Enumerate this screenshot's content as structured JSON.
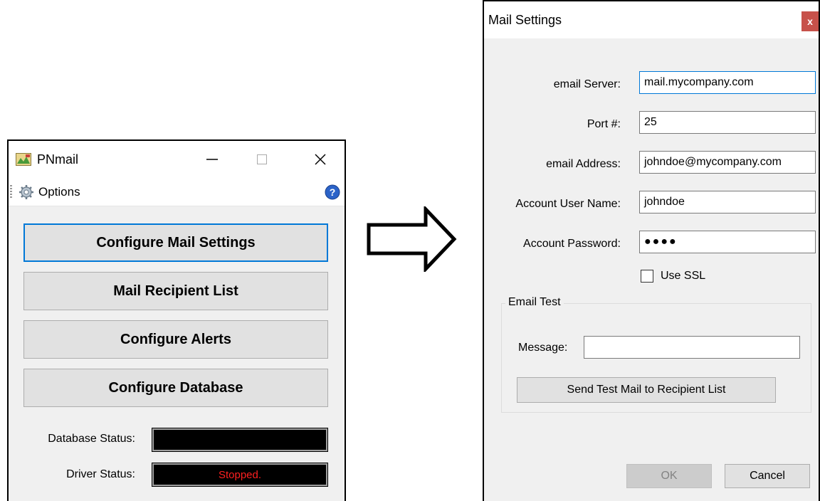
{
  "pnmail": {
    "title": "PNmail",
    "menu": {
      "options_label": "Options"
    },
    "buttons": {
      "configure_mail": "Configure Mail Settings",
      "recipient_list": "Mail Recipient List",
      "configure_alerts": "Configure Alerts",
      "configure_database": "Configure Database"
    },
    "status": {
      "database_label": "Database Status:",
      "database_value": "",
      "driver_label": "Driver Status:",
      "driver_value": "Stopped."
    },
    "icons": [
      "app-icon",
      "minimize-icon",
      "maximize-icon",
      "close-icon",
      "gear-icon",
      "help-icon"
    ]
  },
  "mail_settings": {
    "title": "Mail Settings",
    "close_glyph": "x",
    "fields": {
      "server_label": "email Server:",
      "server_value": "mail.mycompany.com",
      "port_label": "Port #:",
      "port_value": "25",
      "address_label": "email Address:",
      "address_value": "johndoe@mycompany.com",
      "user_label": "Account User Name:",
      "user_value": "johndoe",
      "password_label": "Account Password:",
      "password_value": "●●●●"
    },
    "use_ssl_label": "Use SSL",
    "use_ssl_checked": false,
    "email_test": {
      "group_title": "Email Test",
      "message_label": "Message:",
      "message_value": "",
      "send_button": "Send Test Mail to Recipient List"
    },
    "ok_label": "OK",
    "cancel_label": "Cancel"
  },
  "colors": {
    "focus_blue": "#0078d7",
    "status_red": "#ff2020",
    "close_red": "#c7514a",
    "window_bg": "#f0f0f0"
  }
}
